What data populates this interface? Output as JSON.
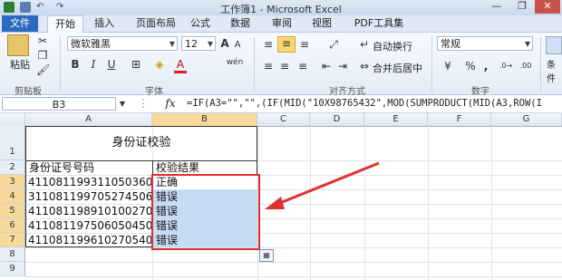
{
  "window": {
    "title": "工作簿1 - Microsoft Excel",
    "min": "—",
    "max": "❐",
    "close": "✕"
  },
  "tabs": [
    "文件",
    "开始",
    "插入",
    "页面布局",
    "公式",
    "数据",
    "审阅",
    "视图",
    "PDF工具集"
  ],
  "ribbon": {
    "clipboard": {
      "paste": "粘贴",
      "label": "剪贴板"
    },
    "font": {
      "name": "微软雅黑",
      "size": "12",
      "bold": "B",
      "italic": "I",
      "underline": "U",
      "grow": "A",
      "shrink": "A",
      "fontcolor": "A",
      "wen": "wén",
      "label": "字体"
    },
    "alignment": {
      "wrap": "自动换行",
      "merge": "合并后居中",
      "label": "对齐方式"
    },
    "number": {
      "format": "常规",
      "percent": "%",
      "comma": ",",
      "dec_inc": ".0→",
      "dec_dec": ".00",
      "label": "数字"
    },
    "styles": {
      "cond": "条件"
    }
  },
  "formula_bar": {
    "name_box": "B3",
    "fx": "fx",
    "formula": "=IF(A3=\"\",\"\",(IF(MID(\"10X98765432\",MOD(SUMPRODUCT(MID(A3,ROW(I"
  },
  "columns": [
    "A",
    "B",
    "C",
    "D",
    "E",
    "F",
    "G"
  ],
  "rows": [
    "1",
    "2",
    "3",
    "4",
    "5",
    "6",
    "7",
    "8",
    "9"
  ],
  "sheet": {
    "title": "身份证校验",
    "header_a": "身份证号号码",
    "header_b": "校验结果",
    "ids": [
      "411081199311050360",
      "311081199705274506",
      "411081198910100270",
      "411081197506050450",
      "411081199610270540"
    ],
    "results": [
      "正确",
      "错误",
      "错误",
      "错误",
      "错误"
    ]
  },
  "colors": {
    "accent": "#2b6bbf",
    "highlight": "#e03030",
    "selection": "#c6dcf5"
  }
}
